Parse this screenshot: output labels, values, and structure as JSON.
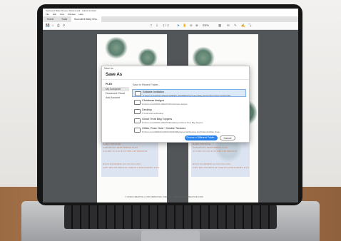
{
  "window": {
    "title": "Succulent Baby Shower Stickers.pdf - Adobe Acrobat",
    "menu": [
      "File",
      "Edit",
      "View",
      "Window",
      "Help"
    ],
    "tabs": [
      "Home",
      "Tools",
      "Succulent Baby Sho..."
    ]
  },
  "toolbar": {
    "page_indicator": "1 / 2",
    "zoom": "59%"
  },
  "document": {
    "big_text": "BY",
    "left_lines": [
      "BABY SHOWER",
      "SATURDAY, SEPTEMBER 25TH",
      "AT ONE O'CLOCK IN THE AFTERNOON",
      "RSVP TO DENISE AT 555-555-5555",
      "GIFT REGISTERED AT TARGET AND BABIES R US"
    ],
    "right_lines": [
      "BABY SHOWER",
      "SATURDAY, SEPTEMBER 25TH",
      "AT ONE O'CLOCK IN THE AFTERNOON",
      "RSVP TO DENISE AT 555-555-5555",
      "GIFT REGISTERED AT TARGET AND BABIES R US"
    ],
    "footer": "© MINA CREATIVE  |  FOR PERSONAL USE ONLY  |  WWW.MINACREATIVE.COM"
  },
  "dialog": {
    "window_title": "Save As",
    "heading": "Save As",
    "sidebar_heading": "PLEX",
    "sidebar_items": [
      "My Computer",
      "Document Cloud",
      "Add Account"
    ],
    "recent_caption": "Save in Recent Folder...",
    "folders": [
      {
        "name": "Editable Invitation",
        "path": "D:\\Documents\\MINA CREATIVE\\BABY SHOWERS\\Succulent Baby Shower\\Succulent Invitation\\Ed..."
      },
      {
        "name": "Christmas designs",
        "path": "D:\\Documents\\MINA CREATIVE\\Christmas designs"
      },
      {
        "name": "Desktop",
        "path": "C:\\Users\\Home\\Desktop"
      },
      {
        "name": "Ghost Treat Bag Toppers",
        "path": "D:\\Documents\\MINA CREATIVE\\Halloween\\Ghost Treat Bag Toppers"
      },
      {
        "name": "Glitter, Rose Gold + Marble Textures",
        "path": "D:\\Documents\\DESIGN RESOURCES\\Backgrounds\\Textures and Patterns\\Glitter, Rose..."
      }
    ],
    "choose_button": "Choose a Different Folder...",
    "cancel_button": "Cancel"
  },
  "colors": {
    "accent": "#2680eb",
    "selected_row": "#dbe9f9"
  }
}
